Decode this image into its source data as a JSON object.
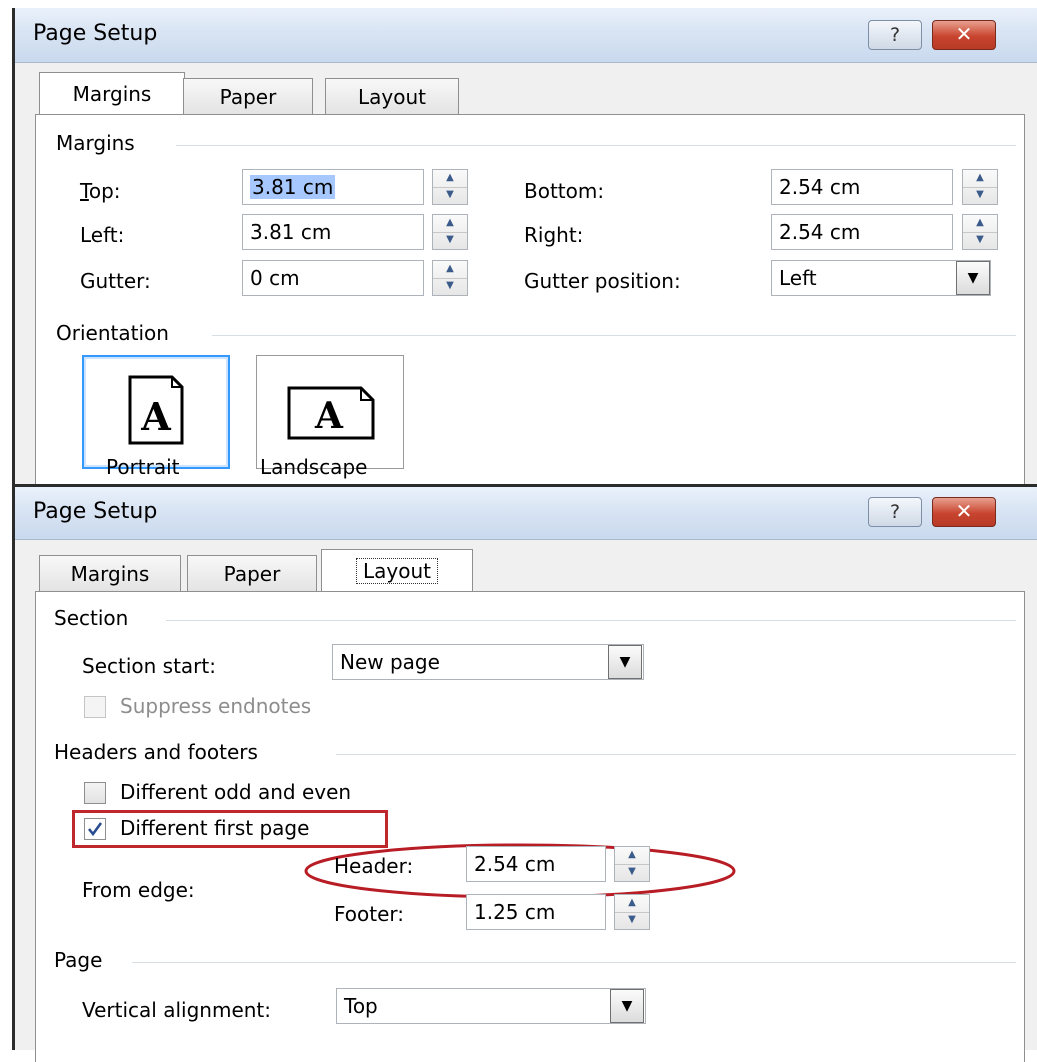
{
  "top_dialog": {
    "title": "Page Setup",
    "help_glyph": "?",
    "close_glyph": "✕",
    "tabs": [
      {
        "label": "Margins",
        "active": true
      },
      {
        "label": "Paper",
        "active": false
      },
      {
        "label": "Layout",
        "active": false
      }
    ],
    "margins": {
      "group_label": "Margins",
      "top_label": "Top:",
      "top_value": "3.81 cm",
      "left_label": "Left:",
      "left_value": "3.81 cm",
      "gutter_label": "Gutter:",
      "gutter_value": "0 cm",
      "bottom_label": "Bottom:",
      "bottom_value": "2.54 cm",
      "right_label": "Right:",
      "right_value": "2.54 cm",
      "gutter_position_label": "Gutter position:",
      "gutter_position_value": "Left"
    },
    "orientation": {
      "group_label": "Orientation",
      "portrait_label": "Portrait",
      "landscape_label": "Landscape",
      "icon_letter": "A",
      "selected": "Portrait"
    }
  },
  "bottom_dialog": {
    "title": "Page Setup",
    "help_glyph": "?",
    "close_glyph": "✕",
    "tabs": [
      {
        "label": "Margins",
        "active": false
      },
      {
        "label": "Paper",
        "active": false
      },
      {
        "label": "Layout",
        "active": true
      }
    ],
    "section": {
      "group_label": "Section",
      "section_start_label": "Section start:",
      "section_start_value": "New page",
      "suppress_endnotes_label": "Suppress endnotes",
      "suppress_endnotes_checked": false
    },
    "headers_footers": {
      "group_label": "Headers and footers",
      "different_odd_even_label": "Different odd and even",
      "different_odd_even_checked": false,
      "different_first_page_label": "Different first page",
      "different_first_page_checked": true,
      "from_edge_label": "From edge:",
      "header_label": "Header:",
      "header_value": "2.54 cm",
      "footer_label": "Footer:",
      "footer_value": "1.25 cm"
    },
    "page": {
      "group_label": "Page",
      "vertical_alignment_label": "Vertical alignment:",
      "vertical_alignment_value": "Top"
    }
  },
  "annotation_colors": {
    "highlight_box": "#c0272d",
    "highlight_ellipse": "#b81c24"
  }
}
